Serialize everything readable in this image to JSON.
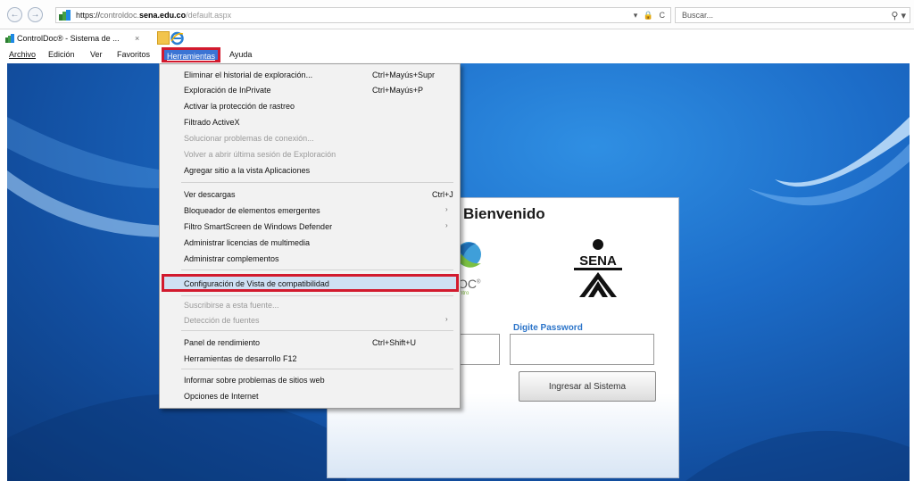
{
  "browser": {
    "url": {
      "protocol": "https://",
      "host_sub": "controldoc.",
      "host_domain": "sena.edu.co",
      "path": "/default.aspx"
    },
    "url_tools": "▾ 🔒 C",
    "search_placeholder": "Buscar...",
    "search_icon_glyph": "⚲ ▾",
    "back_glyph": "←",
    "forward_glyph": "→",
    "tab": {
      "title": "ControlDoc® - Sistema de ...",
      "close": "×"
    }
  },
  "menubar": {
    "archivo": "Archivo",
    "edicion": "Edición",
    "ver": "Ver",
    "favoritos": "Favoritos",
    "herramientas": "Herramientas",
    "ayuda": "Ayuda"
  },
  "tools_menu": {
    "items": [
      {
        "label": "Eliminar el historial de exploración...",
        "shortcut": "Ctrl+Mayús+Supr"
      },
      {
        "label": "Exploración de InPrivate",
        "shortcut": "Ctrl+Mayús+P"
      },
      {
        "label": "Activar la protección de rastreo",
        "shortcut": ""
      },
      {
        "label": "Filtrado ActiveX",
        "shortcut": ""
      },
      {
        "label": "Solucionar problemas de conexión...",
        "shortcut": ""
      },
      {
        "label": "Volver a abrir última sesión de Exploración",
        "shortcut": ""
      },
      {
        "label": "Agregar sitio a la vista Aplicaciones",
        "shortcut": ""
      },
      {
        "label": "Ver descargas",
        "shortcut": "Ctrl+J"
      },
      {
        "label": "Bloqueador de elementos emergentes",
        "shortcut": ""
      },
      {
        "label": "Filtro SmartScreen de Windows Defender",
        "shortcut": ""
      },
      {
        "label": "Administrar licencias de multimedia",
        "shortcut": ""
      },
      {
        "label": "Administrar complementos",
        "shortcut": ""
      },
      {
        "label": "Configuración de Vista de compatibilidad",
        "shortcut": ""
      },
      {
        "label": "Suscribirse a esta fuente...",
        "shortcut": ""
      },
      {
        "label": "Detección de fuentes",
        "shortcut": ""
      },
      {
        "label": "Panel de rendimiento",
        "shortcut": "Ctrl+Shift+U"
      },
      {
        "label": "Herramientas de desarrollo F12",
        "shortcut": ""
      },
      {
        "label": "Informar sobre problemas de sitios web",
        "shortcut": ""
      },
      {
        "label": "Opciones de Internet",
        "shortcut": ""
      }
    ],
    "submenu_arrow": "›"
  },
  "login": {
    "title": "Bienvenido",
    "controldoc_fragment": "OC",
    "controldoc_registered": "®",
    "controldoc_sub": "ntro",
    "sena_text": "SENA",
    "password_label": "Digite Password",
    "submit_label": "Ingresar al Sistema"
  },
  "colors": {
    "menu_highlight": "#3b74d4",
    "annotation_red": "#d21a2e",
    "password_label": "#2b74c9",
    "desktop_blue": "#1c6cc8"
  },
  "icons": [
    "back-icon",
    "forward-icon",
    "site-favicon",
    "lock-icon",
    "refresh-icon",
    "search-icon",
    "close-icon",
    "new-tab-icon",
    "ie-icon",
    "submenu-arrow-icon",
    "controldoc-logo",
    "sena-logo"
  ]
}
